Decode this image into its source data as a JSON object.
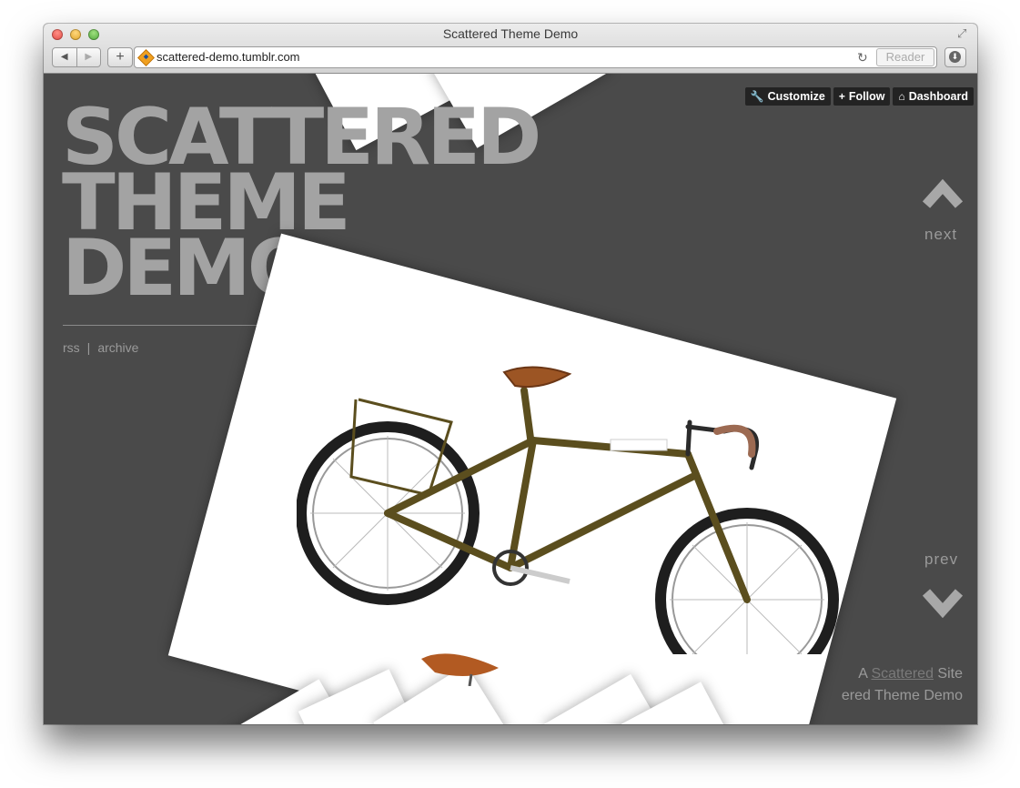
{
  "window": {
    "title": "Scattered Theme Demo",
    "url": "scattered-demo.tumblr.com",
    "reader_label": "Reader",
    "back_icon": "◀",
    "forward_icon": "▶",
    "new_tab_icon": "+",
    "reload_icon": "↻",
    "fullscreen_icon": "⤢",
    "download_icon": "⬇"
  },
  "blog": {
    "title_lines": [
      "SCATTERED",
      "THEME",
      "DEMO"
    ],
    "links": {
      "rss": "rss",
      "separator": "|",
      "archive": "archive"
    }
  },
  "tumblr_controls": {
    "customize": {
      "icon": "🔧",
      "label": "Customize"
    },
    "follow": {
      "icon": "+",
      "label": "Follow"
    },
    "dashboard": {
      "icon": "⌂",
      "label": "Dashboard"
    }
  },
  "nav": {
    "next": "next",
    "prev": "prev"
  },
  "footer": {
    "line1_prefix": "A",
    "line1_link": "Scattered",
    "line1_suffix": "Site",
    "line2": "ered Theme Demo"
  },
  "colors": {
    "background": "#4a4a4a",
    "title": "#a3a3a3",
    "muted_text": "#9a9a9a",
    "control_bg": "#232323"
  }
}
